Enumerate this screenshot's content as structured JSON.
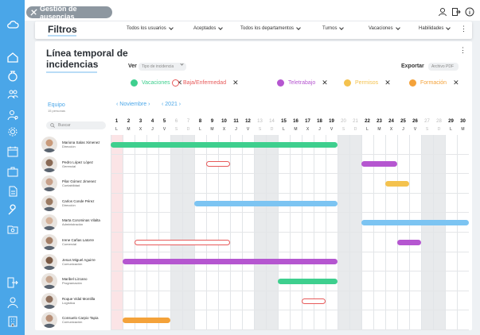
{
  "app": {
    "title": "Gestión de ausencias"
  },
  "colors": {
    "sidebar": "#4aa6e8",
    "vacaciones": "#3ecf8e",
    "baja": "#e75a5a",
    "teletrabajo": "#b556d0",
    "permisos": "#f4c24e",
    "formacion": "#f4a23a",
    "accent": "#4aa6e8"
  },
  "sidebar": {
    "items": [
      {
        "icon": "cloud-icon"
      },
      {
        "icon": "home-icon"
      },
      {
        "icon": "money-bag-icon"
      },
      {
        "icon": "users-icon"
      },
      {
        "icon": "user-settings-icon"
      },
      {
        "icon": "gear-icon"
      },
      {
        "icon": "calendar-icon"
      },
      {
        "icon": "briefcase-icon"
      },
      {
        "icon": "document-icon"
      },
      {
        "icon": "wrench-icon"
      },
      {
        "icon": "folder-search-icon"
      },
      {
        "icon": "logout-icon"
      },
      {
        "icon": "user-icon"
      },
      {
        "icon": "building-icon"
      }
    ]
  },
  "top_icons": [
    "user-icon",
    "logout-icon",
    "info-icon"
  ],
  "filters": {
    "title": "Filtros",
    "dropdowns": [
      {
        "label": "Todos los usuarios"
      },
      {
        "label": "Aceptados"
      },
      {
        "label": "Todos los departamentos"
      },
      {
        "label": "Turnos"
      },
      {
        "label": "Vacaciones"
      },
      {
        "label": "Habilidades"
      }
    ],
    "more": "⋮"
  },
  "timeline": {
    "title": "Línea temporal de incidencias",
    "more": "⋮",
    "ver_label": "Ver",
    "ver_value": "Tipo de incidencia",
    "export_label": "Exportar",
    "export_value": "Archivo PDF",
    "legend": [
      {
        "label": "Vacaciones",
        "type": "vacaciones"
      },
      {
        "label": "Baja/Enfermedad",
        "type": "baja"
      },
      {
        "label": "Teletrabajo",
        "type": "teletrabajo"
      },
      {
        "label": "Permisos",
        "type": "permisos"
      },
      {
        "label": "Formación",
        "type": "formacion"
      }
    ],
    "team_label": "Equipo",
    "team_sub": "15 personas",
    "search_placeholder": "Buscar",
    "month": "Noviembre",
    "year": "2021",
    "days": [
      {
        "n": "1",
        "l": "L"
      },
      {
        "n": "2",
        "l": "M"
      },
      {
        "n": "3",
        "l": "X"
      },
      {
        "n": "4",
        "l": "J"
      },
      {
        "n": "5",
        "l": "V"
      },
      {
        "n": "6",
        "l": "S",
        "w": true
      },
      {
        "n": "7",
        "l": "D",
        "w": true
      },
      {
        "n": "8",
        "l": "L"
      },
      {
        "n": "9",
        "l": "M"
      },
      {
        "n": "10",
        "l": "X"
      },
      {
        "n": "11",
        "l": "J"
      },
      {
        "n": "12",
        "l": "V"
      },
      {
        "n": "13",
        "l": "S",
        "w": true
      },
      {
        "n": "14",
        "l": "D",
        "w": true
      },
      {
        "n": "15",
        "l": "L"
      },
      {
        "n": "16",
        "l": "M"
      },
      {
        "n": "17",
        "l": "X"
      },
      {
        "n": "18",
        "l": "J"
      },
      {
        "n": "19",
        "l": "V"
      },
      {
        "n": "20",
        "l": "S",
        "w": true
      },
      {
        "n": "21",
        "l": "D",
        "w": true
      },
      {
        "n": "22",
        "l": "L"
      },
      {
        "n": "23",
        "l": "M"
      },
      {
        "n": "24",
        "l": "X"
      },
      {
        "n": "25",
        "l": "J"
      },
      {
        "n": "26",
        "l": "V"
      },
      {
        "n": "27",
        "l": "S",
        "w": true
      },
      {
        "n": "28",
        "l": "D",
        "w": true
      },
      {
        "n": "29",
        "l": "L"
      },
      {
        "n": "30",
        "l": "M"
      }
    ],
    "holiday_day": "1",
    "employees": [
      {
        "name": "Mariona Salas Ximenez",
        "role": "Dirección",
        "bars": [
          {
            "type": "vacaciones",
            "start": 1,
            "end": 19
          }
        ]
      },
      {
        "name": "Pedro López López",
        "role": "Gerencial",
        "bars": [
          {
            "type": "baja",
            "start": 9,
            "end": 10
          },
          {
            "type": "teletrabajo",
            "start": 22,
            "end": 24
          }
        ]
      },
      {
        "name": "Pilar Gómez Jimenez",
        "role": "Contabilidad",
        "bars": [
          {
            "type": "permisos",
            "start": 24,
            "end": 25
          }
        ]
      },
      {
        "name": "Carlos Conde Pérez",
        "role": "Dirección",
        "bars": [
          {
            "type": "vacaciones_blue",
            "start": 8,
            "end": 19
          }
        ]
      },
      {
        "name": "Marta Corominas Vilalta",
        "role": "Administración",
        "bars": [
          {
            "type": "vacaciones_blue",
            "start": 22,
            "end": 30
          }
        ]
      },
      {
        "name": "Irene Cañas Latorre",
        "role": "Comercial",
        "bars": [
          {
            "type": "baja",
            "start": 3,
            "end": 10
          },
          {
            "type": "teletrabajo",
            "start": 25,
            "end": 26
          }
        ]
      },
      {
        "name": "Jesus Miguel Aguirre",
        "role": "Comunicación",
        "bars": [
          {
            "type": "teletrabajo",
            "start": 2,
            "end": 19
          }
        ]
      },
      {
        "name": "Maribel Lizcano",
        "role": "Programación",
        "bars": [
          {
            "type": "vacaciones",
            "start": 15,
            "end": 19
          }
        ]
      },
      {
        "name": "Roque Vidal Montilla",
        "role": "Logística",
        "bars": [
          {
            "type": "baja",
            "start": 17,
            "end": 18
          }
        ]
      },
      {
        "name": "Consuelo Carpio Tapia",
        "role": "Comunicación",
        "bars": [
          {
            "type": "formacion",
            "start": 2,
            "end": 5
          }
        ]
      }
    ]
  }
}
